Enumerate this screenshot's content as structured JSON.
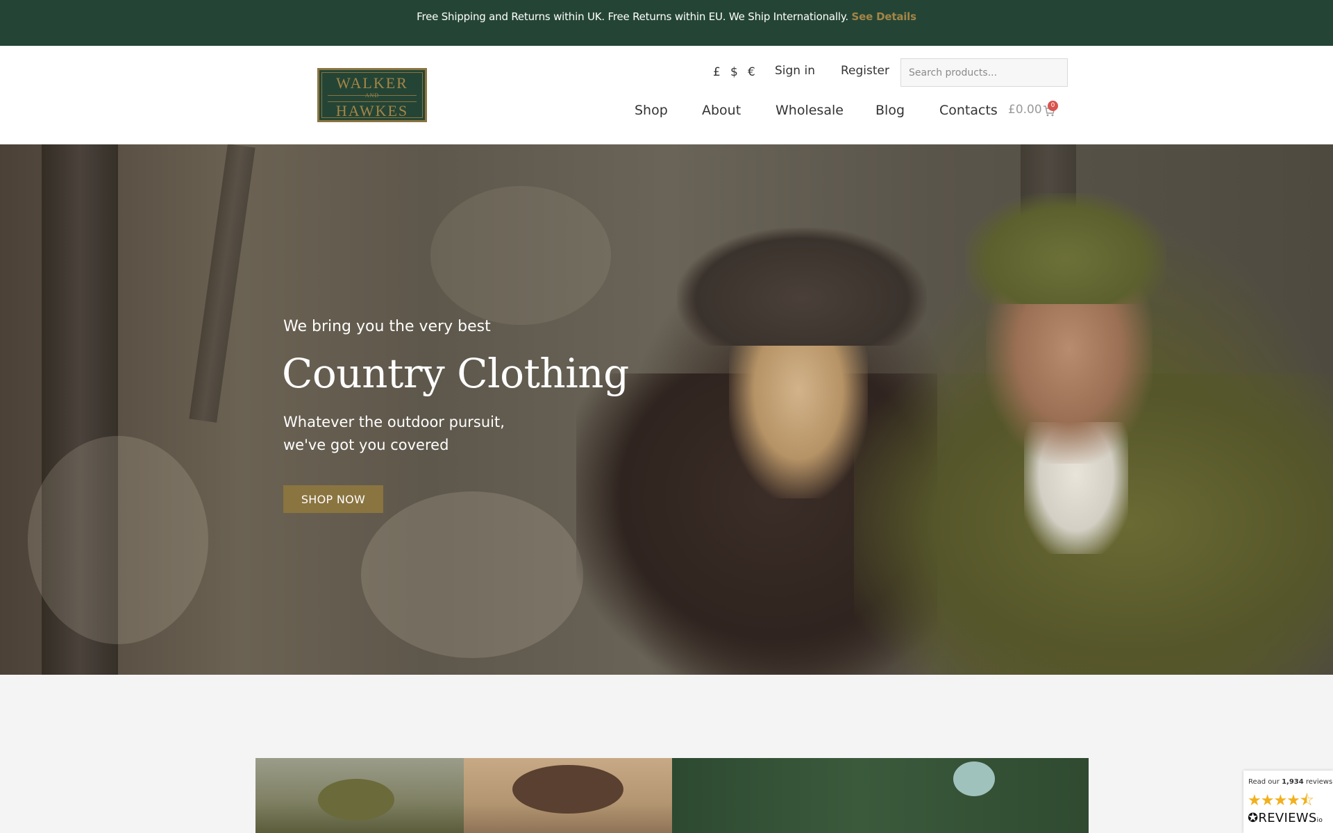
{
  "banner": {
    "text": "Free Shipping and Returns within UK. Free Returns within EU. We Ship Internationally.",
    "link": "See Details"
  },
  "logo": {
    "line1": "WALKER",
    "line2": "AND",
    "line3": "HAWKES"
  },
  "header": {
    "currencies": [
      "£",
      "$",
      "€"
    ],
    "sign_in": "Sign in",
    "register": "Register",
    "search_placeholder": "Search products..."
  },
  "nav": {
    "items": [
      "Shop",
      "About",
      "Wholesale",
      "Blog",
      "Contacts"
    ],
    "cart_total": "£0.00",
    "cart_count": "0"
  },
  "hero": {
    "subtitle": "We bring you the very best",
    "title": "Country Clothing",
    "text_line1": "Whatever the outdoor pursuit,",
    "text_line2": "we've got you covered",
    "button": "SHOP NOW"
  },
  "reviews_widget": {
    "prefix": "Read our",
    "count": "1,934",
    "suffix": "reviews",
    "rating": 4.5,
    "brand": "REVIEWS",
    "brand_suffix": "io"
  },
  "colors": {
    "banner_bg": "#244535",
    "accent_gold": "#a48547",
    "button_gold": "#8a7440",
    "badge_red": "#d9534f"
  }
}
